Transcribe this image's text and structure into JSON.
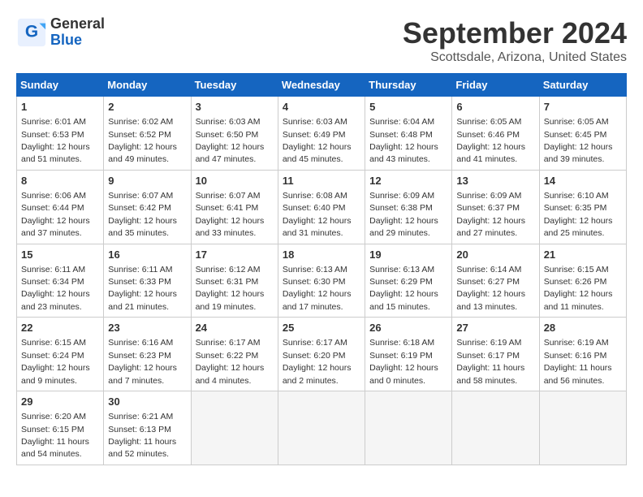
{
  "header": {
    "logo_general": "General",
    "logo_blue": "Blue",
    "month_title": "September 2024",
    "location": "Scottsdale, Arizona, United States"
  },
  "weekdays": [
    "Sunday",
    "Monday",
    "Tuesday",
    "Wednesday",
    "Thursday",
    "Friday",
    "Saturday"
  ],
  "weeks": [
    [
      {
        "day": "1",
        "sunrise": "6:01 AM",
        "sunset": "6:53 PM",
        "daylight": "12 hours and 51 minutes."
      },
      {
        "day": "2",
        "sunrise": "6:02 AM",
        "sunset": "6:52 PM",
        "daylight": "12 hours and 49 minutes."
      },
      {
        "day": "3",
        "sunrise": "6:03 AM",
        "sunset": "6:50 PM",
        "daylight": "12 hours and 47 minutes."
      },
      {
        "day": "4",
        "sunrise": "6:03 AM",
        "sunset": "6:49 PM",
        "daylight": "12 hours and 45 minutes."
      },
      {
        "day": "5",
        "sunrise": "6:04 AM",
        "sunset": "6:48 PM",
        "daylight": "12 hours and 43 minutes."
      },
      {
        "day": "6",
        "sunrise": "6:05 AM",
        "sunset": "6:46 PM",
        "daylight": "12 hours and 41 minutes."
      },
      {
        "day": "7",
        "sunrise": "6:05 AM",
        "sunset": "6:45 PM",
        "daylight": "12 hours and 39 minutes."
      }
    ],
    [
      {
        "day": "8",
        "sunrise": "6:06 AM",
        "sunset": "6:44 PM",
        "daylight": "12 hours and 37 minutes."
      },
      {
        "day": "9",
        "sunrise": "6:07 AM",
        "sunset": "6:42 PM",
        "daylight": "12 hours and 35 minutes."
      },
      {
        "day": "10",
        "sunrise": "6:07 AM",
        "sunset": "6:41 PM",
        "daylight": "12 hours and 33 minutes."
      },
      {
        "day": "11",
        "sunrise": "6:08 AM",
        "sunset": "6:40 PM",
        "daylight": "12 hours and 31 minutes."
      },
      {
        "day": "12",
        "sunrise": "6:09 AM",
        "sunset": "6:38 PM",
        "daylight": "12 hours and 29 minutes."
      },
      {
        "day": "13",
        "sunrise": "6:09 AM",
        "sunset": "6:37 PM",
        "daylight": "12 hours and 27 minutes."
      },
      {
        "day": "14",
        "sunrise": "6:10 AM",
        "sunset": "6:35 PM",
        "daylight": "12 hours and 25 minutes."
      }
    ],
    [
      {
        "day": "15",
        "sunrise": "6:11 AM",
        "sunset": "6:34 PM",
        "daylight": "12 hours and 23 minutes."
      },
      {
        "day": "16",
        "sunrise": "6:11 AM",
        "sunset": "6:33 PM",
        "daylight": "12 hours and 21 minutes."
      },
      {
        "day": "17",
        "sunrise": "6:12 AM",
        "sunset": "6:31 PM",
        "daylight": "12 hours and 19 minutes."
      },
      {
        "day": "18",
        "sunrise": "6:13 AM",
        "sunset": "6:30 PM",
        "daylight": "12 hours and 17 minutes."
      },
      {
        "day": "19",
        "sunrise": "6:13 AM",
        "sunset": "6:29 PM",
        "daylight": "12 hours and 15 minutes."
      },
      {
        "day": "20",
        "sunrise": "6:14 AM",
        "sunset": "6:27 PM",
        "daylight": "12 hours and 13 minutes."
      },
      {
        "day": "21",
        "sunrise": "6:15 AM",
        "sunset": "6:26 PM",
        "daylight": "12 hours and 11 minutes."
      }
    ],
    [
      {
        "day": "22",
        "sunrise": "6:15 AM",
        "sunset": "6:24 PM",
        "daylight": "12 hours and 9 minutes."
      },
      {
        "day": "23",
        "sunrise": "6:16 AM",
        "sunset": "6:23 PM",
        "daylight": "12 hours and 7 minutes."
      },
      {
        "day": "24",
        "sunrise": "6:17 AM",
        "sunset": "6:22 PM",
        "daylight": "12 hours and 4 minutes."
      },
      {
        "day": "25",
        "sunrise": "6:17 AM",
        "sunset": "6:20 PM",
        "daylight": "12 hours and 2 minutes."
      },
      {
        "day": "26",
        "sunrise": "6:18 AM",
        "sunset": "6:19 PM",
        "daylight": "12 hours and 0 minutes."
      },
      {
        "day": "27",
        "sunrise": "6:19 AM",
        "sunset": "6:17 PM",
        "daylight": "11 hours and 58 minutes."
      },
      {
        "day": "28",
        "sunrise": "6:19 AM",
        "sunset": "6:16 PM",
        "daylight": "11 hours and 56 minutes."
      }
    ],
    [
      {
        "day": "29",
        "sunrise": "6:20 AM",
        "sunset": "6:15 PM",
        "daylight": "11 hours and 54 minutes."
      },
      {
        "day": "30",
        "sunrise": "6:21 AM",
        "sunset": "6:13 PM",
        "daylight": "11 hours and 52 minutes."
      },
      null,
      null,
      null,
      null,
      null
    ]
  ]
}
